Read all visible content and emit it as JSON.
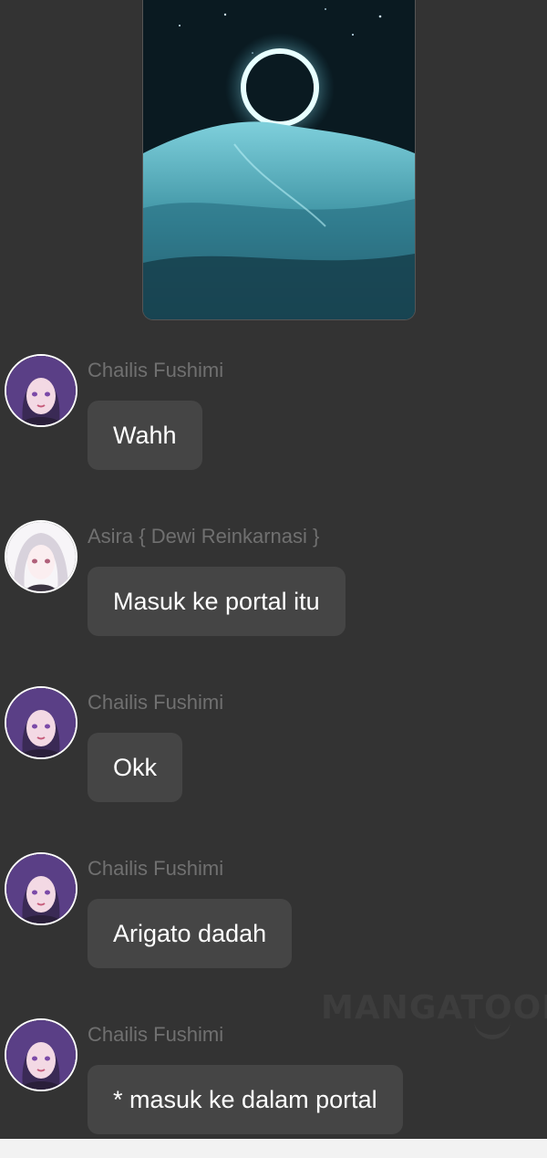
{
  "watermark": "MANGATOON",
  "messages": [
    {
      "sender": "Chailis Fushimi",
      "text": "Wahh"
    },
    {
      "sender": "Asira { Dewi Reinkarnasi }",
      "text": "Masuk ke portal itu"
    },
    {
      "sender": "Chailis Fushimi",
      "text": "Okk"
    },
    {
      "sender": "Chailis Fushimi",
      "text": "Arigato dadah"
    },
    {
      "sender": "Chailis Fushimi",
      "text": "* masuk ke dalam portal"
    }
  ],
  "colors": {
    "background": "#333333",
    "bubble": "#454545",
    "sender_name": "#707070",
    "message_text": "#ffffff"
  }
}
